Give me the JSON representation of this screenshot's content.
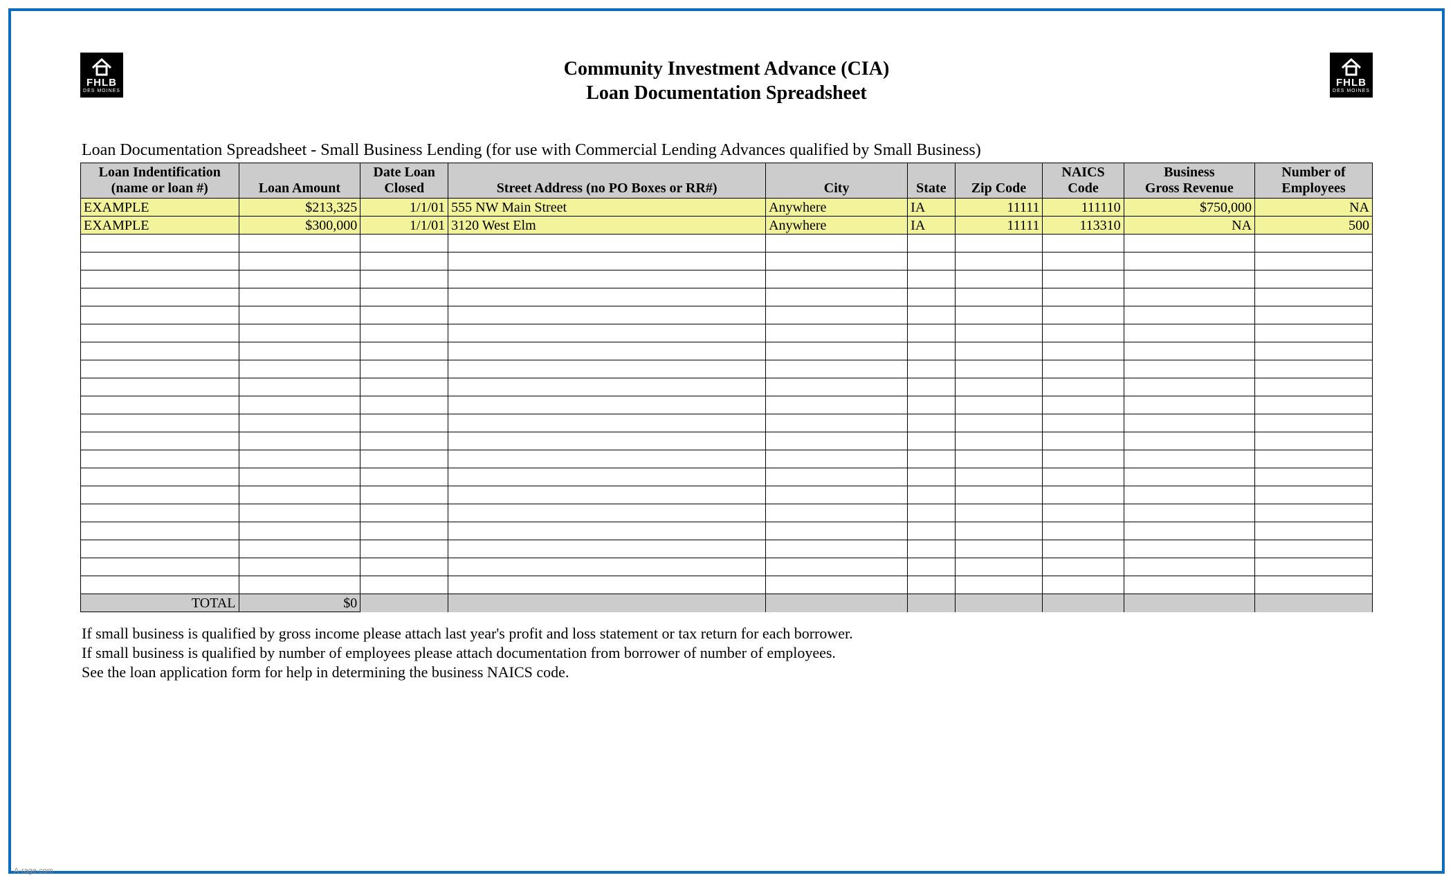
{
  "logo": {
    "line1": "FHLB",
    "line2": "DES MOINES"
  },
  "title": {
    "line1": "Community Investment Advance (CIA)",
    "line2": "Loan Documentation Spreadsheet"
  },
  "subtitle": "Loan Documentation Spreadsheet - Small Business Lending (for use with Commercial Lending Advances qualified by Small Business)",
  "columns": {
    "loan_id": {
      "l1": "Loan Indentification",
      "l2": "(name or loan #)"
    },
    "amount": {
      "l1": "",
      "l2": "Loan Amount"
    },
    "closed": {
      "l1": "Date Loan",
      "l2": "Closed"
    },
    "street": {
      "l1": "",
      "l2": "Street Address (no PO Boxes or RR#)"
    },
    "city": {
      "l1": "",
      "l2": "City"
    },
    "state": {
      "l1": "",
      "l2": "State"
    },
    "zip": {
      "l1": "",
      "l2": "Zip Code"
    },
    "naics": {
      "l1": "NAICS",
      "l2": "Code"
    },
    "revenue": {
      "l1": "Business",
      "l2": "Gross Revenue"
    },
    "employees": {
      "l1": "Number of",
      "l2": "Employees"
    }
  },
  "rows": [
    {
      "loan_id": "EXAMPLE",
      "amount": "$213,325",
      "closed": "1/1/01",
      "street": "555 NW Main Street",
      "city": "Anywhere",
      "state": "IA",
      "zip": "11111",
      "naics": "111110",
      "revenue": "$750,000",
      "employees": "NA"
    },
    {
      "loan_id": "EXAMPLE",
      "amount": "$300,000",
      "closed": "1/1/01",
      "street": "3120 West Elm",
      "city": "Anywhere",
      "state": "IA",
      "zip": "11111",
      "naics": "113310",
      "revenue": "NA",
      "employees": "500"
    }
  ],
  "blank_row_count": 20,
  "total": {
    "label": "TOTAL",
    "amount": "$0"
  },
  "notes": [
    "If small business is qualified by gross income please attach last year's profit and loss statement or tax return for each borrower.",
    "If small business is qualified by number of employees please attach documentation from borrower of number of employees.",
    "See the loan application form for help in determining the business NAICS code."
  ],
  "watermark": "A-rage.com"
}
